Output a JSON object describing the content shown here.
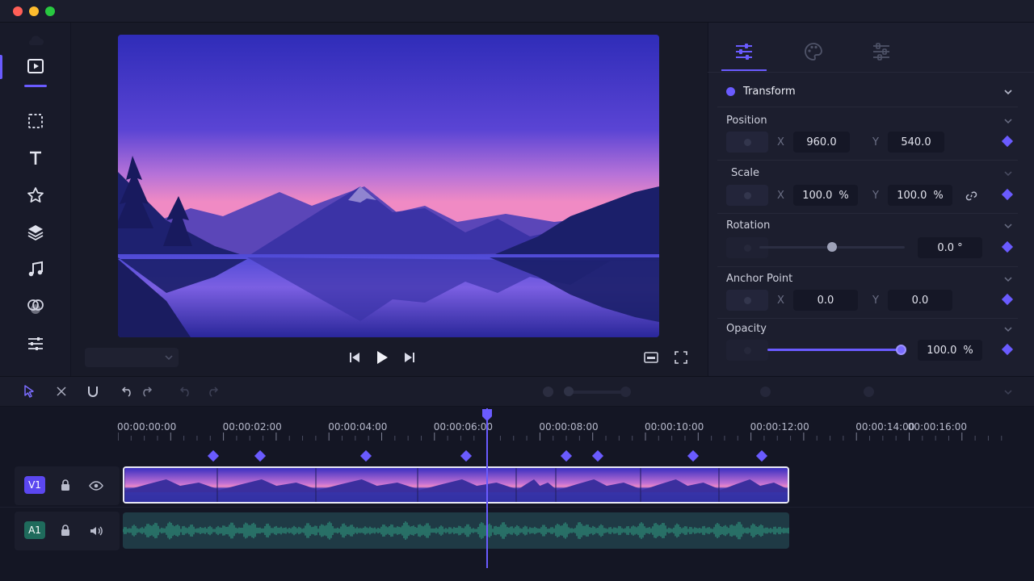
{
  "window": {
    "traffic_lights": [
      "#ff5f57",
      "#febc2e",
      "#28c840"
    ]
  },
  "rail": {
    "items": [
      {
        "name": "media-icon",
        "active": true
      },
      {
        "name": "crop-icon"
      },
      {
        "name": "text-icon"
      },
      {
        "name": "star-icon"
      },
      {
        "name": "layers-icon"
      },
      {
        "name": "music-icon"
      },
      {
        "name": "color-icon"
      },
      {
        "name": "adjust-icon"
      }
    ]
  },
  "inspector": {
    "tabs": [
      {
        "name": "tab-transform-adjust",
        "active": true
      },
      {
        "name": "tab-color-palette"
      },
      {
        "name": "tab-effects"
      }
    ],
    "section_title": "Transform",
    "position": {
      "label": "Position",
      "x_axis": "X",
      "y_axis": "Y",
      "x": "960.0",
      "y": "540.0"
    },
    "scale": {
      "label": "Scale",
      "x_axis": "X",
      "y_axis": "Y",
      "x": "100.0",
      "y": "100.0",
      "unit": "%"
    },
    "rotation": {
      "label": "Rotation",
      "value": "0.0 °",
      "slider_fraction": 0.5
    },
    "anchor": {
      "label": "Anchor Point",
      "x_axis": "X",
      "y_axis": "Y",
      "x": "0.0",
      "y": "0.0"
    },
    "opacity": {
      "label": "Opacity",
      "value": "100.0",
      "unit": "%",
      "slider_fraction": 1.0
    }
  },
  "timeline": {
    "timecodes": [
      "00:00:00:00",
      "00:00:02:00",
      "00:00:04:00",
      "00:00:06:00",
      "00:00:08:00",
      "00:00:10:00",
      "00:00:12:00",
      "00:00:14:00",
      "00:00:16:00"
    ],
    "playhead_time_seconds": 7.0,
    "keyframe_times_seconds": [
      1.8,
      2.7,
      4.7,
      6.6,
      8.5,
      9.1,
      10.9,
      12.2
    ],
    "tracks": [
      {
        "tag": "V1",
        "kind": "video",
        "tag_color": "#5b47f0"
      },
      {
        "tag": "A1",
        "kind": "audio",
        "tag_color": "#1f6b5c"
      }
    ]
  },
  "colors": {
    "accent": "#6a5bff",
    "waveform": "#2e8f7a"
  }
}
